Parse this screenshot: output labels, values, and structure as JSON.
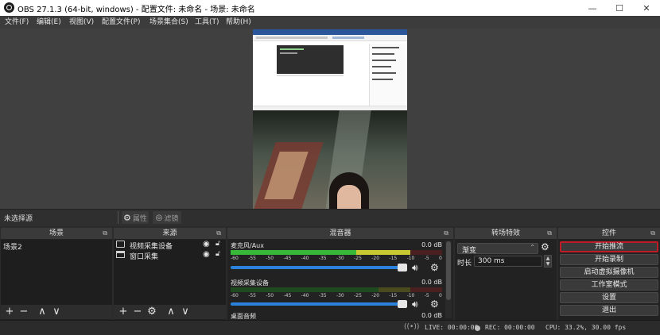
{
  "window": {
    "title": "OBS 27.1.3 (64-bit, windows) - 配置文件: 未命名 - 场景: 未命名",
    "minimize": "—",
    "maximize": "☐",
    "close": "✕"
  },
  "menu": [
    "文件(F)",
    "编辑(E)",
    "视图(V)",
    "配置文件(P)",
    "场景集合(S)",
    "工具(T)",
    "帮助(H)"
  ],
  "source_bar": {
    "status": "未选择源",
    "properties": "属性",
    "filters": "滤镜"
  },
  "scenes": {
    "title": "场景",
    "items": [
      "场景2"
    ]
  },
  "sources": {
    "title": "来源",
    "items": [
      "视频采集设备",
      "窗口采集"
    ]
  },
  "mixer": {
    "title": "混音器",
    "channels": [
      {
        "name": "麦克风/Aux",
        "db": "0.0 dB",
        "level": 0.85
      },
      {
        "name": "视频采集设备",
        "db": "0.0 dB",
        "level": 0.0
      },
      {
        "name": "桌面音频",
        "db": "0.0 dB",
        "level": 0.0
      }
    ],
    "scale": [
      "-60",
      "-55",
      "-50",
      "-45",
      "-40",
      "-35",
      "-30",
      "-25",
      "-20",
      "-15",
      "-10",
      "-5",
      "0"
    ]
  },
  "transitions": {
    "title": "转场特效",
    "type": "渐变",
    "duration_label": "时长",
    "duration": "300 ms"
  },
  "controls": {
    "title": "控件",
    "buttons": [
      "开始推流",
      "开始录制",
      "启动虚拟摄像机",
      "工作室模式",
      "设置",
      "退出"
    ]
  },
  "status": {
    "live": "LIVE: 00:00:00",
    "rec": "REC: 00:00:00",
    "cpu": "CPU: 33.2%, 30.00 fps"
  },
  "colors": {
    "accent_red": "#c01c28",
    "meter_green": "#38b838",
    "meter_yellow": "#c8c832",
    "meter_red": "#c83232",
    "slider_blue": "#2a82da"
  }
}
